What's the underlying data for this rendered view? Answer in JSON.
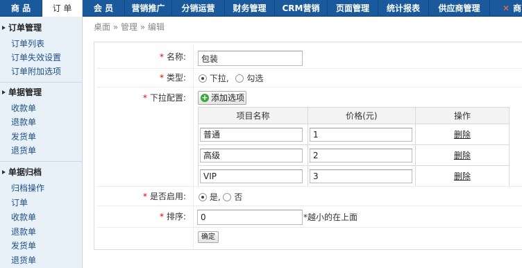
{
  "nav": {
    "tabs": [
      {
        "label": "商 品"
      },
      {
        "label": "订 单"
      },
      {
        "label": "会 员"
      },
      {
        "label": "营销推广"
      },
      {
        "label": "分销运营"
      },
      {
        "label": "财务管理"
      },
      {
        "label": "CRM营销"
      },
      {
        "label": "页面管理"
      },
      {
        "label": "统计报表"
      },
      {
        "label": "供应商管理"
      },
      {
        "label": "商"
      }
    ]
  },
  "sidebar": {
    "sections": [
      {
        "title": "订单管理",
        "items": [
          "订单列表",
          "订单失效设置",
          "订单附加选项"
        ]
      },
      {
        "title": "单据管理",
        "items": [
          "收款单",
          "退款单",
          "发货单",
          "退货单"
        ]
      },
      {
        "title": "单据归档",
        "items": [
          "归档操作",
          "订单",
          "收款单",
          "退款单",
          "发货单",
          "退货单"
        ]
      }
    ]
  },
  "breadcrumb": {
    "items": [
      "桌面",
      "管理",
      "编辑"
    ],
    "separator": "»"
  },
  "form": {
    "name_label": "名称:",
    "name_value": "包装",
    "type_label": "类型:",
    "type_option_dropdown": "下拉,",
    "type_option_check": "勾选",
    "dropdown_config_label": "下拉配置:",
    "add_option_label": "添加选项",
    "table": {
      "headers": [
        "项目名称",
        "价格(元)",
        "操作"
      ],
      "rows": [
        {
          "name": "普通",
          "price": "1",
          "action": "删除"
        },
        {
          "name": "高级",
          "price": "2",
          "action": "删除"
        },
        {
          "name": "VIP",
          "price": "3",
          "action": "删除"
        }
      ]
    },
    "enabled_label": "是否启用:",
    "enabled_yes": "是,",
    "enabled_no": "否",
    "sort_label": "排序:",
    "sort_value": "0",
    "sort_hint": "*越小的在上面",
    "submit_label": "确定"
  },
  "colors": {
    "nav_bg": "#1a5a9c",
    "sidebar_bg": "#e9f1f8",
    "required": "#dd0000",
    "link": "#1d4f89"
  }
}
